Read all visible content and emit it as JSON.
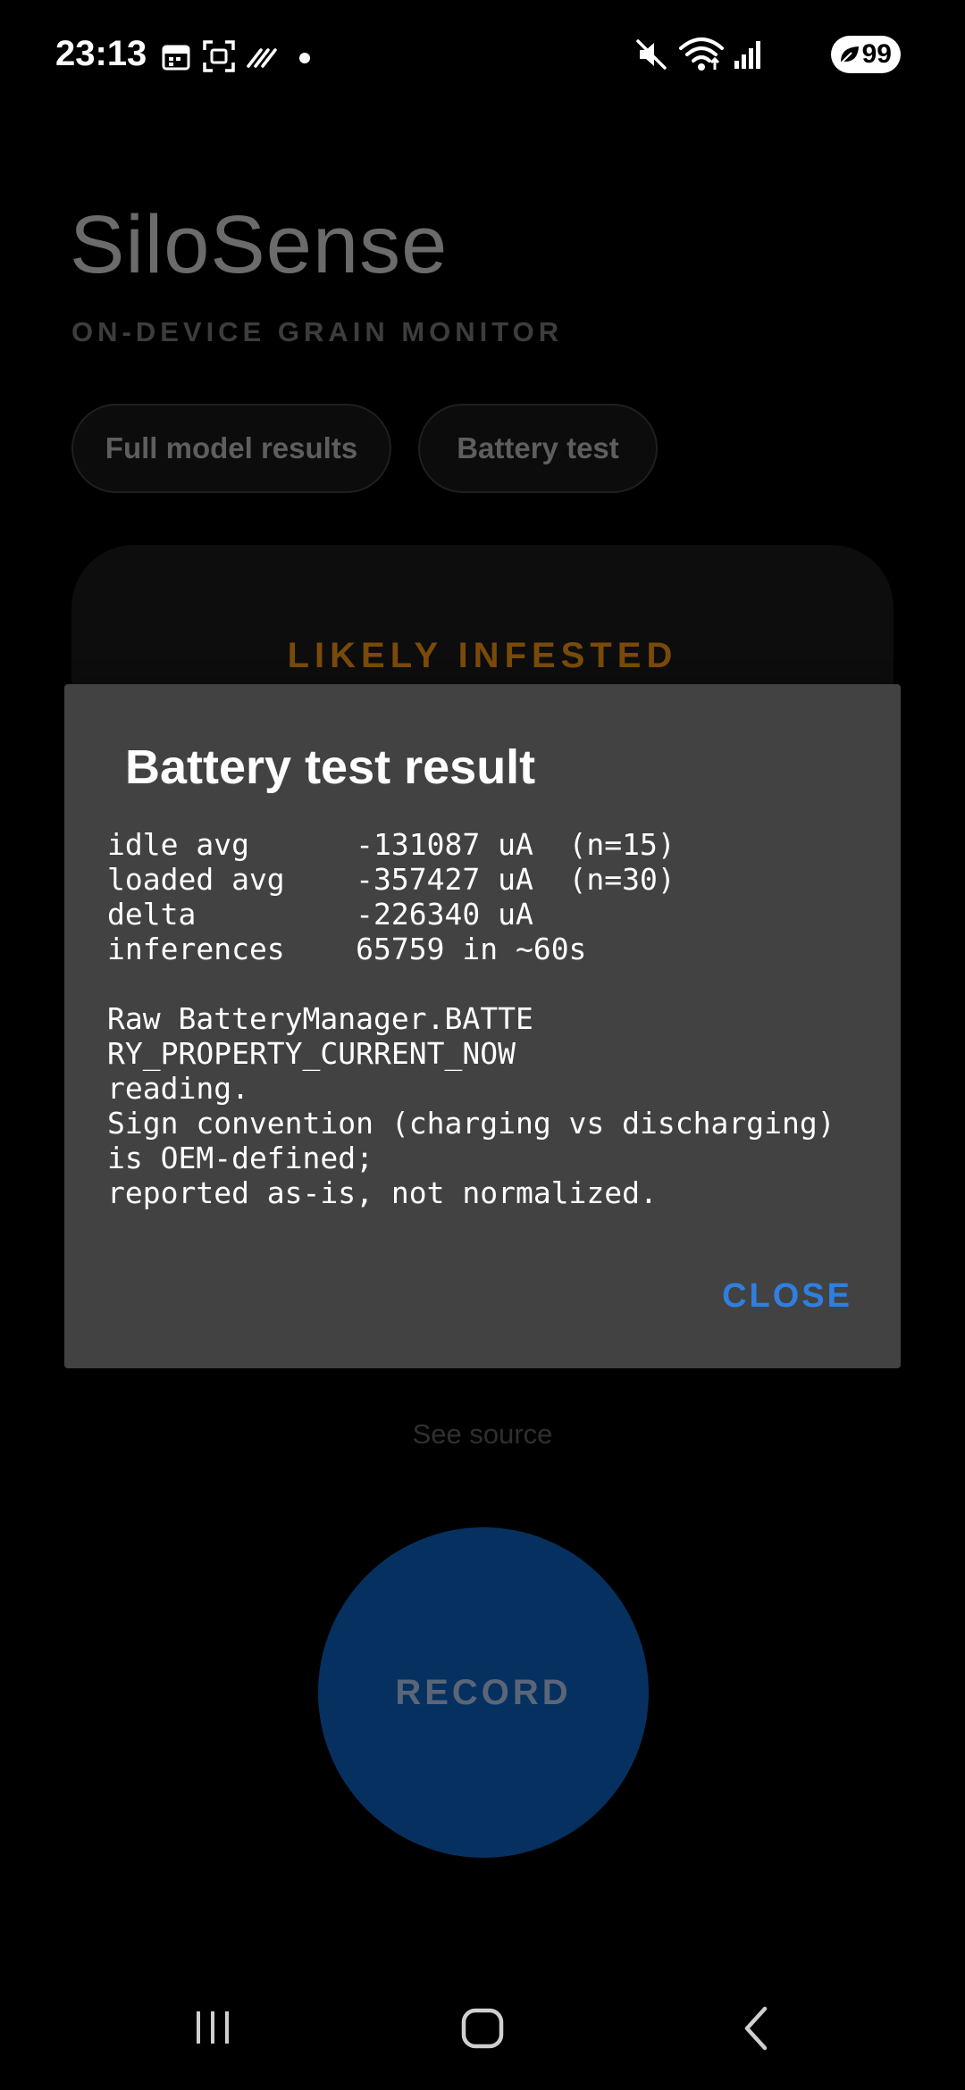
{
  "status_bar": {
    "time": "23:13",
    "battery_level": "99",
    "icons_left": [
      "calendar-icon",
      "screenshot-icon",
      "nfc-icon",
      "dot-icon"
    ],
    "icons_right": [
      "mute-icon",
      "wifi-icon",
      "signal-icon",
      "battery-icon"
    ]
  },
  "app": {
    "title": "SiloSense",
    "subtitle": "ON-DEVICE GRAIN MONITOR",
    "chips": {
      "full_model": "Full model results",
      "battery_test": "Battery test"
    },
    "result_status": "LIKELY INFESTED",
    "see_source": "See source",
    "record_label": "RECORD",
    "colors": {
      "status_orange": "#7a4a0a",
      "record_blue": "#06305f"
    }
  },
  "dialog": {
    "title": "Battery test result",
    "body": "idle avg      -131087 uA  (n=15)\nloaded avg    -357427 uA  (n=30)\ndelta         -226340 uA\ninferences    65759 in ~60s\n\nRaw BatteryManager.BATTE\nRY_PROPERTY_CURRENT_NOW\nreading.\nSign convention (charging vs discharging)\nis OEM-defined;\nreported as-is, not normalized.",
    "close_label": "CLOSE",
    "accent_color": "#2f7fe0"
  },
  "nav_bar": {
    "buttons": [
      "recents-icon",
      "home-icon",
      "back-icon"
    ]
  }
}
